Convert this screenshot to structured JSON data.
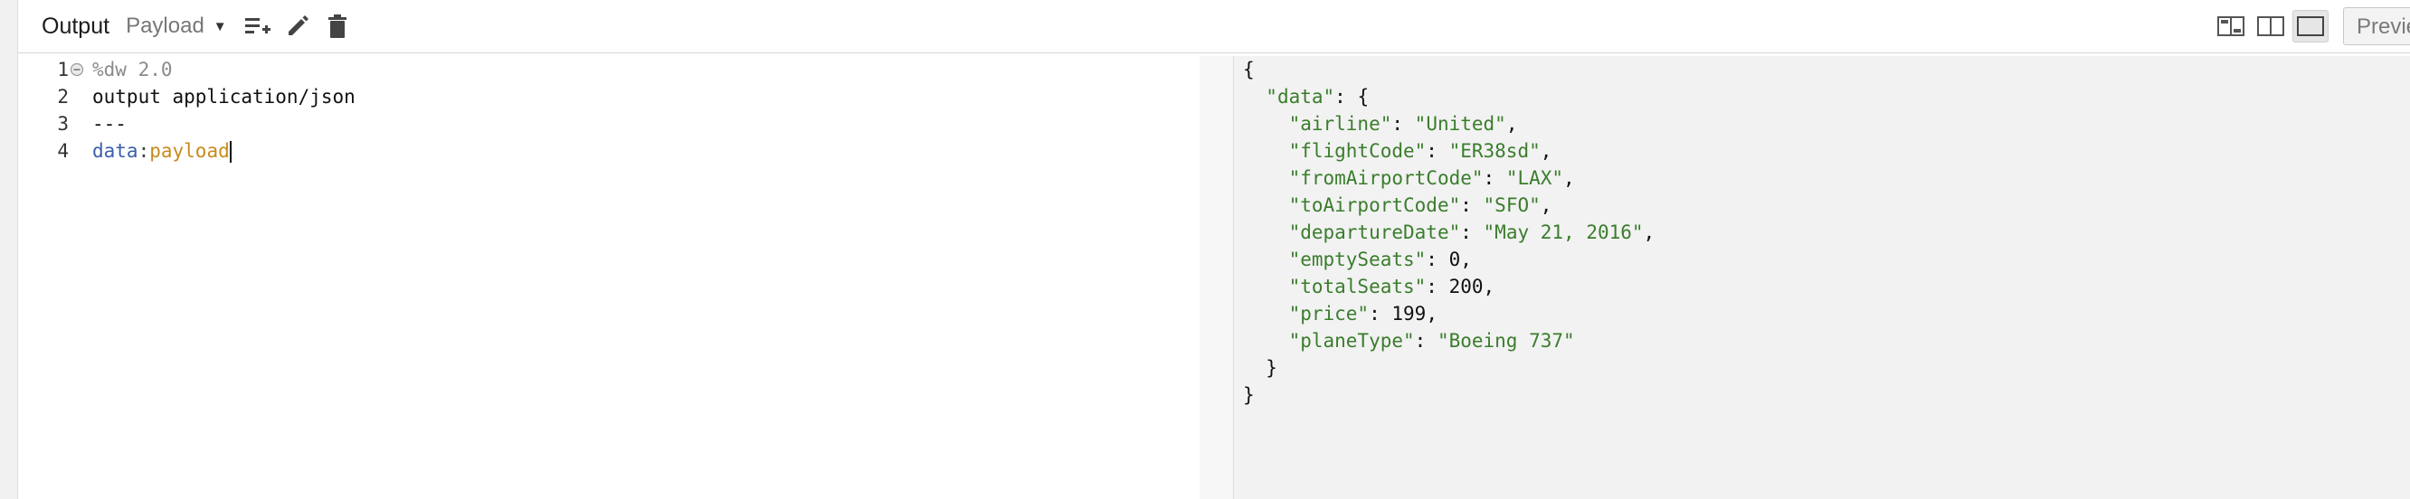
{
  "toolbar": {
    "title": "Output",
    "select_value": "Payload",
    "icons": [
      "add-list-icon",
      "pencil-icon",
      "trash-icon"
    ],
    "view_modes": [
      "split-vertical-icon",
      "split-columns-icon",
      "single-pane-icon"
    ],
    "preview_label": "Preview"
  },
  "editor": {
    "line_numbers": [
      "1",
      "2",
      "3",
      "4"
    ],
    "lines": {
      "l1": "%dw 2.0",
      "l2": "output application/json",
      "l3": "---",
      "l4_key": "data",
      "l4_colon": ":",
      "l4_val": "payload"
    }
  },
  "output": {
    "open_brace": "{",
    "data_key": "\"data\"",
    "data_open": ": {",
    "fields": [
      {
        "key": "\"airline\"",
        "value": "\"United\"",
        "type": "string"
      },
      {
        "key": "\"flightCode\"",
        "value": "\"ER38sd\"",
        "type": "string"
      },
      {
        "key": "\"fromAirportCode\"",
        "value": "\"LAX\"",
        "type": "string"
      },
      {
        "key": "\"toAirportCode\"",
        "value": "\"SFO\"",
        "type": "string"
      },
      {
        "key": "\"departureDate\"",
        "value": "\"May 21, 2016\"",
        "type": "string"
      },
      {
        "key": "\"emptySeats\"",
        "value": "0",
        "type": "number"
      },
      {
        "key": "\"totalSeats\"",
        "value": "200",
        "type": "number"
      },
      {
        "key": "\"price\"",
        "value": "199",
        "type": "number"
      },
      {
        "key": "\"planeType\"",
        "value": "\"Boeing 737\"",
        "type": "string"
      }
    ],
    "inner_close": "}",
    "outer_close": "}"
  },
  "colors": {
    "keyword": "#3b5ea8",
    "value": "#c88a1c",
    "json_string": "#3a7d2c",
    "output_bg": "#f2f2f2"
  }
}
